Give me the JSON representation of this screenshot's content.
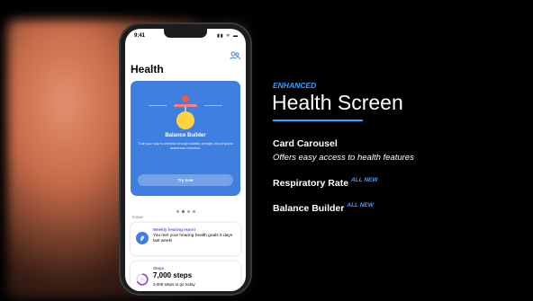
{
  "phone": {
    "status_time": "9:41",
    "status_icons": "▮▮ ᯤ ▬",
    "screen_title": "Health",
    "card": {
      "title": "Balance Builder",
      "description": "Train your way to wellness through stability, strength, and physical awareness exercises.",
      "button": "Try now"
    },
    "carousel_pages": 4,
    "carousel_active_index": 1,
    "section_label": "TODAY",
    "hearing": {
      "heading": "Weekly hearing report",
      "body": "You met your hearing health goals 5 days last week!"
    },
    "steps": {
      "heading": "Steps",
      "count": "7,000 steps",
      "remaining": "3,000 steps to go today"
    }
  },
  "panel": {
    "eyebrow": "ENHANCED",
    "heading": "Health Screen",
    "features": [
      {
        "title": "Card Carousel",
        "subtitle": "Offers easy access to health features",
        "tag": ""
      },
      {
        "title": "Respiratory Rate",
        "subtitle": "",
        "tag": "ALL NEW"
      },
      {
        "title": "Balance Builder",
        "subtitle": "",
        "tag": "ALL NEW"
      }
    ]
  },
  "colors": {
    "accent": "#3aa0ff",
    "card_blue": "#3f7fe0",
    "hearing_purple": "#7b4fd6",
    "steps_purple": "#9a3fd0",
    "background": "#000000"
  },
  "icons": [
    "people-icon",
    "ear-icon",
    "steps-ring-icon",
    "balance-figure-icon"
  ]
}
